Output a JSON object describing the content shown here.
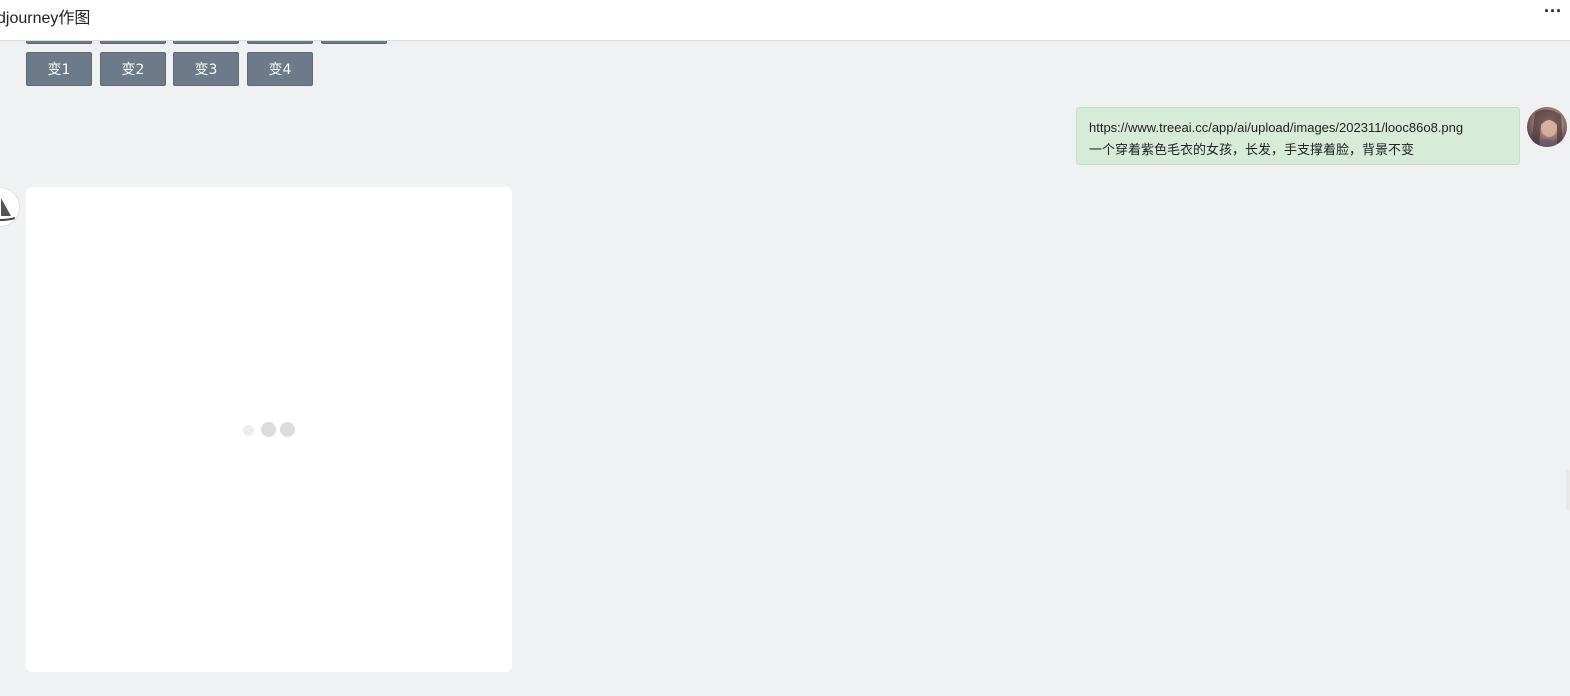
{
  "window": {
    "title": "djourney作图",
    "more_label": "···"
  },
  "variation_buttons": [
    "变1",
    "变2",
    "变3",
    "变4"
  ],
  "user_message": {
    "url": "https://www.treeai.cc/app/ai/upload/images/202311/looc86o8.png",
    "prompt": "一个穿着紫色毛衣的女孩，长发，手支撑着脸，背景不变"
  },
  "bot_message": {
    "status": "loading"
  }
}
